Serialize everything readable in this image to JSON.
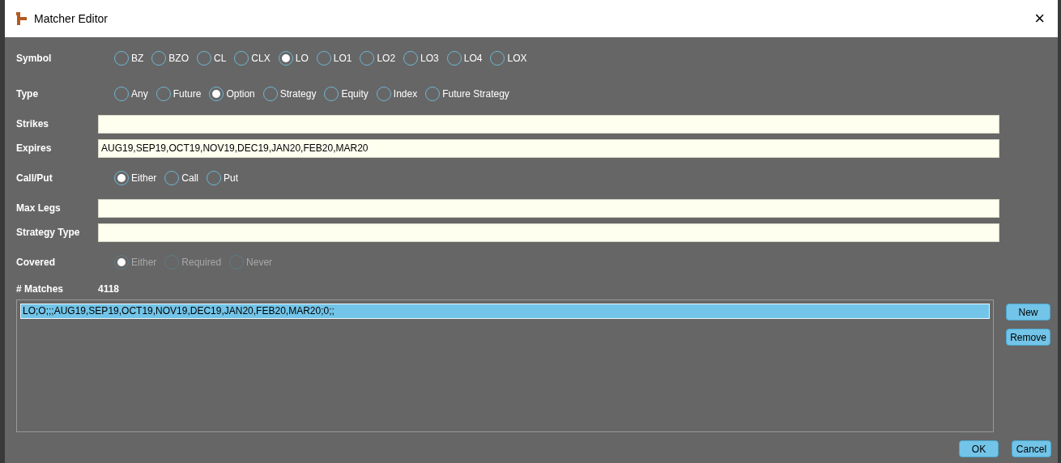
{
  "window": {
    "title": "Matcher Editor",
    "close": "×"
  },
  "rows": [
    {
      "kind": "radio",
      "label": "Symbol",
      "disabled": false,
      "options": [
        {
          "label": "BZ",
          "selected": false
        },
        {
          "label": "BZO",
          "selected": false
        },
        {
          "label": "CL",
          "selected": false
        },
        {
          "label": "CLX",
          "selected": false
        },
        {
          "label": "LO",
          "selected": true
        },
        {
          "label": "LO1",
          "selected": false
        },
        {
          "label": "LO2",
          "selected": false
        },
        {
          "label": "LO3",
          "selected": false
        },
        {
          "label": "LO4",
          "selected": false
        },
        {
          "label": "LOX",
          "selected": false
        }
      ]
    },
    {
      "kind": "radio",
      "label": "Type",
      "disabled": false,
      "options": [
        {
          "label": "Any",
          "selected": false
        },
        {
          "label": "Future",
          "selected": false
        },
        {
          "label": "Option",
          "selected": true
        },
        {
          "label": "Strategy",
          "selected": false
        },
        {
          "label": "Equity",
          "selected": false
        },
        {
          "label": "Index",
          "selected": false
        },
        {
          "label": "Future Strategy",
          "selected": false
        }
      ]
    },
    {
      "kind": "field",
      "label": "Strikes"
    },
    {
      "kind": "field",
      "label": "Expires",
      "value": "AUG19,SEP19,OCT19,NOV19,DEC19,JAN20,FEB20,MAR20"
    },
    {
      "kind": "radio",
      "label": "Call/Put",
      "disabled": false,
      "options": [
        {
          "label": "Either",
          "selected": true
        },
        {
          "label": "Call",
          "selected": false
        },
        {
          "label": "Put",
          "selected": false
        }
      ]
    },
    {
      "kind": "field",
      "label": "Max Legs"
    },
    {
      "kind": "field",
      "label": "Strategy Type"
    },
    {
      "kind": "radio",
      "label": "Covered",
      "disabled": true,
      "options": [
        {
          "label": "Either",
          "selected": true
        },
        {
          "label": "Required",
          "selected": false
        },
        {
          "label": "Never",
          "selected": false
        }
      ]
    },
    {
      "kind": "count",
      "label": "# Matches",
      "value": "4118"
    }
  ],
  "list": {
    "items": [
      {
        "text": "LO;O;;;AUG19,SEP19,OCT19,NOV19,DEC19,JAN20,FEB20,MAR20;0;;",
        "selected": true
      }
    ]
  },
  "side_buttons": [
    "New",
    "Remove"
  ],
  "footer_buttons": [
    "OK",
    "Cancel"
  ]
}
